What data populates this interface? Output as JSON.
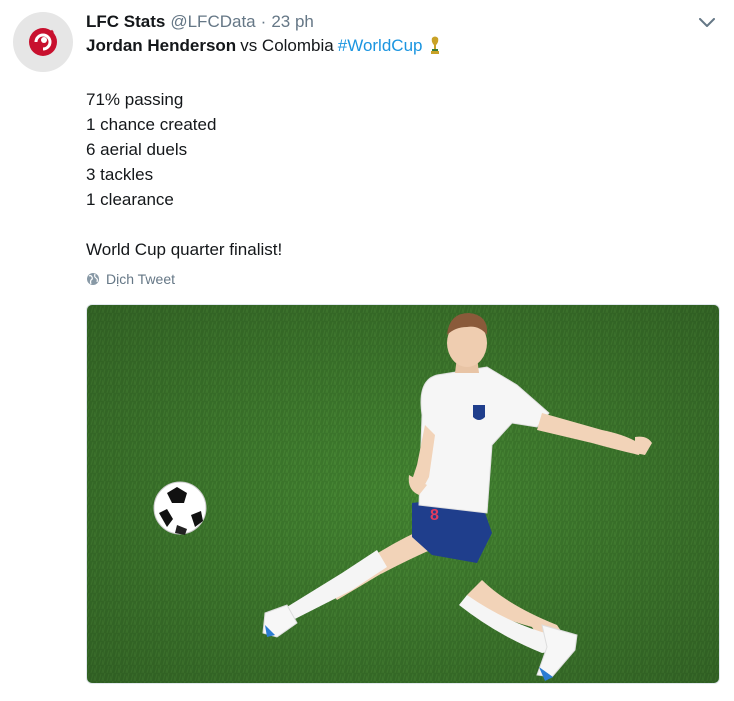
{
  "tweet": {
    "author": {
      "display_name": "LFC Stats",
      "handle": "@LFCData",
      "separator": "·",
      "time": "23 ph",
      "avatar_icon": "liverbird-logo-icon"
    },
    "headline": {
      "player": "Jordan Henderson",
      "opponent": "vs Colombia",
      "hashtag": "#WorldCup",
      "emoji_icon": "world-cup-trophy-icon"
    },
    "stats": [
      "71% passing",
      "1 chance created",
      "6 aerial duels",
      "3 tackles",
      "1 clearance"
    ],
    "closing": "World Cup quarter finalist!",
    "translate_label": "Dịch Tweet",
    "translate_icon": "globe-icon",
    "menu_icon": "chevron-down-icon",
    "media": {
      "jersey_number": "8",
      "icon": "photo-football-player"
    }
  },
  "colors": {
    "text": "#14171a",
    "muted": "#657786",
    "link": "#1b95e0",
    "pitch": "#3e7a2c",
    "avatar_red": "#c8102e"
  }
}
